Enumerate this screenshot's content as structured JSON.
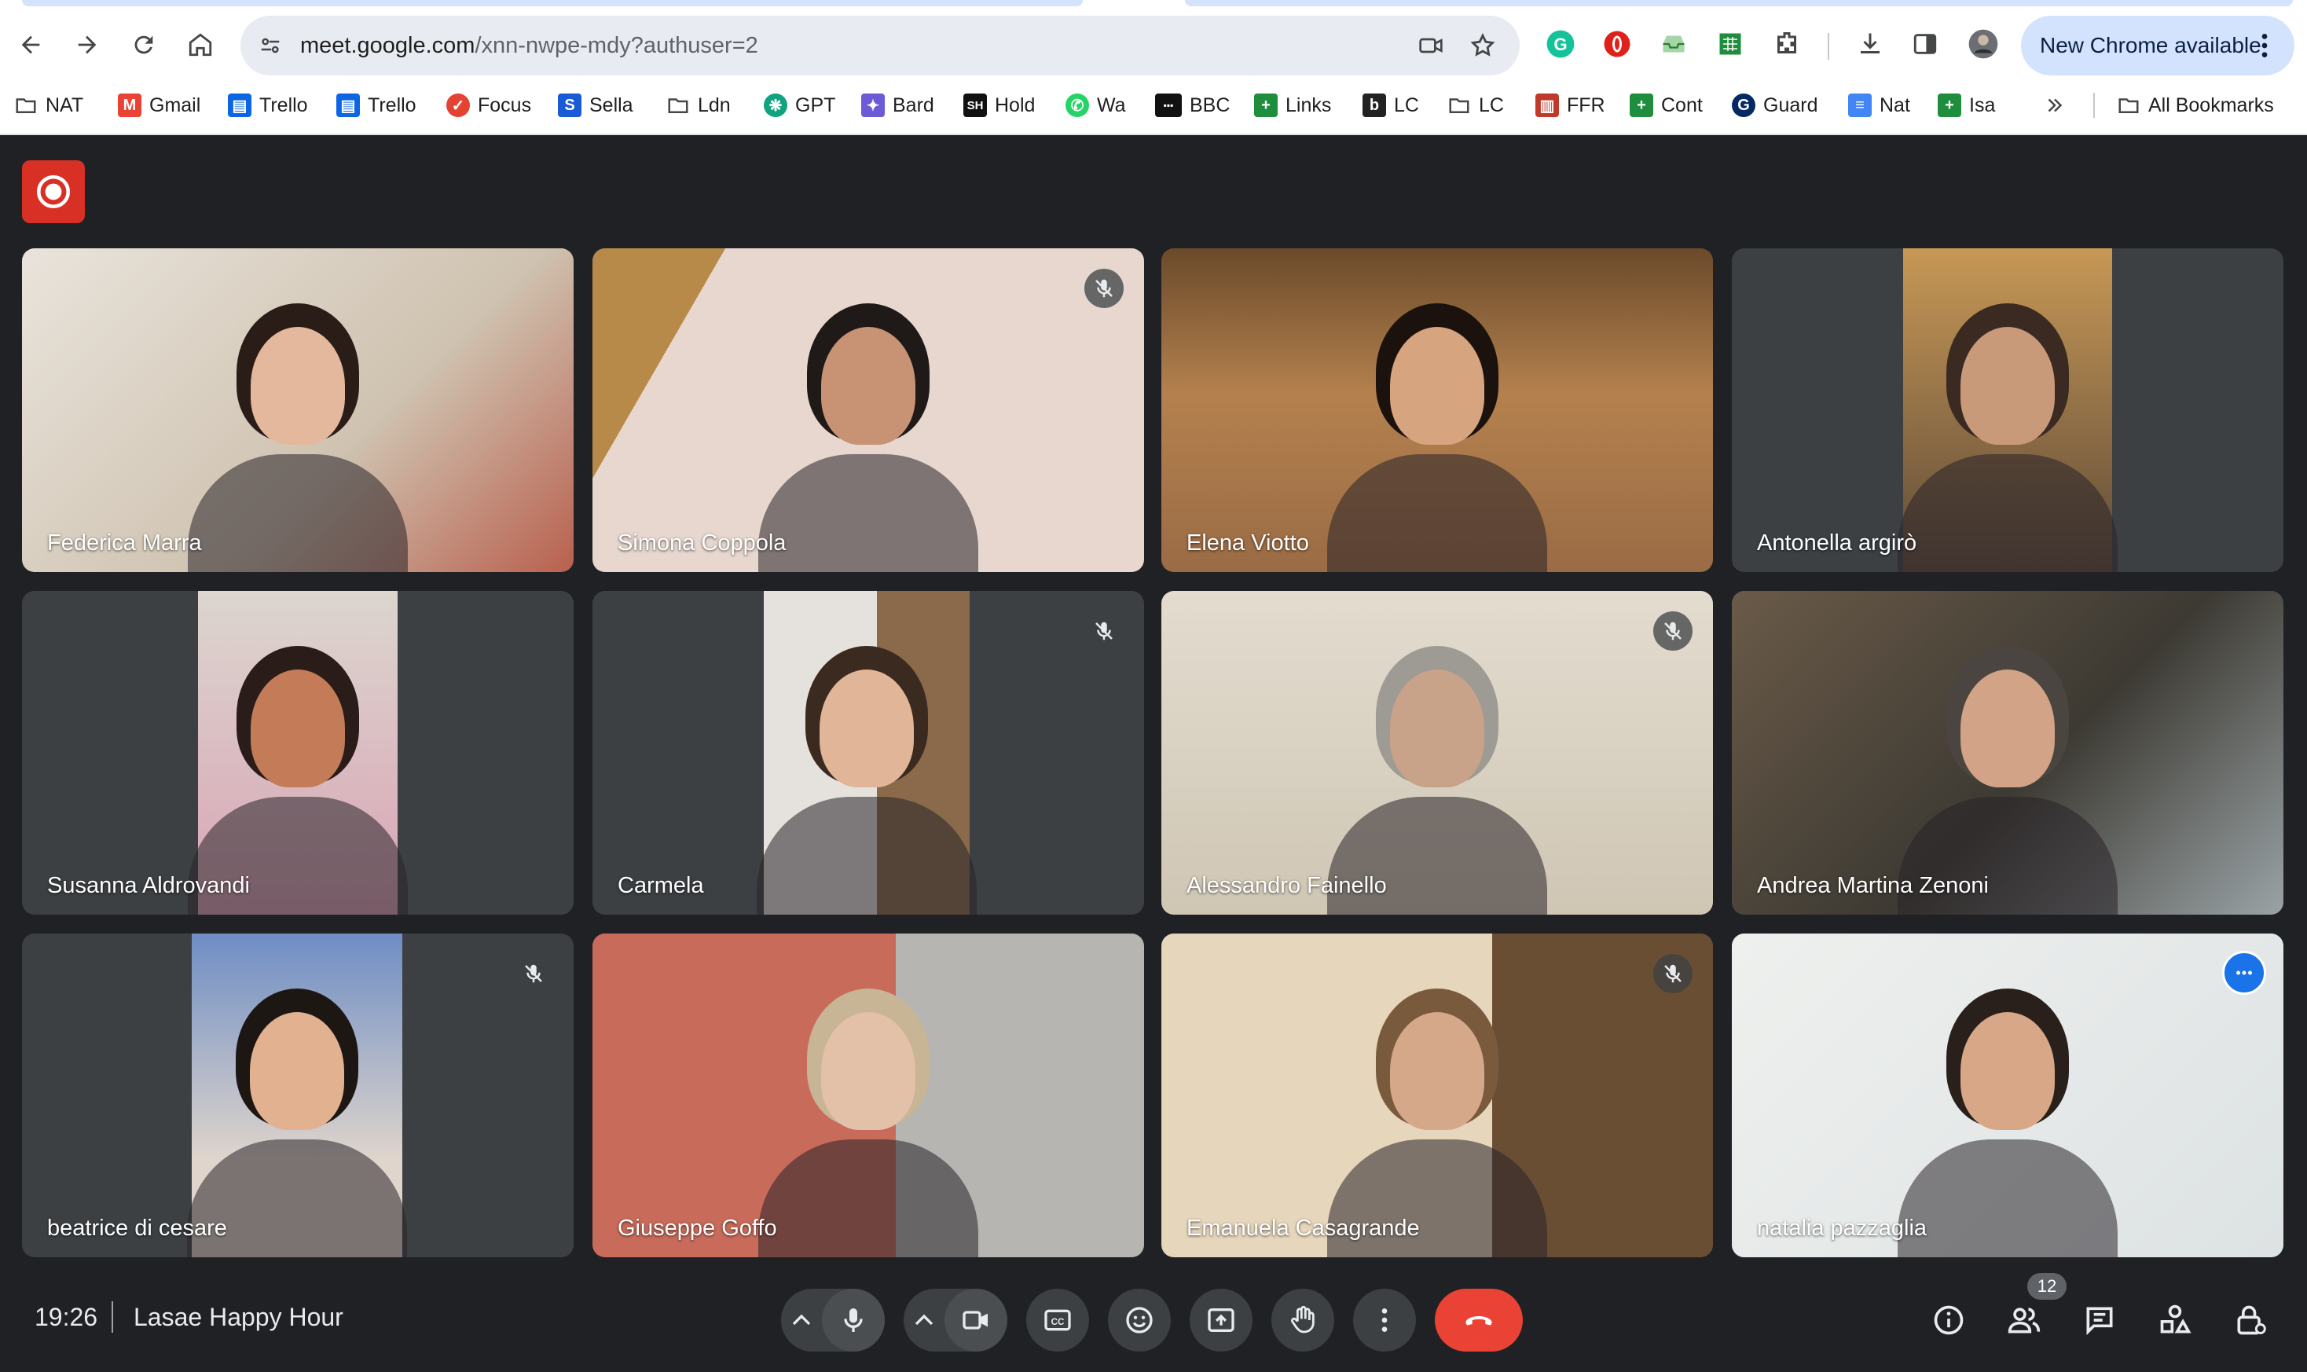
{
  "browser": {
    "url_host": "meet.google.com",
    "url_path": "/xnn-nwpe-mdy?authuser=2",
    "update_label": "New Chrome available",
    "bookmarks": [
      {
        "label": "NAT",
        "icon": "folder-icon"
      },
      {
        "label": "Gmail",
        "icon": "gmail-icon"
      },
      {
        "label": "Trello",
        "icon": "trello-icon"
      },
      {
        "label": "Trello",
        "icon": "trello-icon"
      },
      {
        "label": "Focus",
        "icon": "focus-icon"
      },
      {
        "label": "Sella",
        "icon": "sella-icon"
      },
      {
        "label": "Ldn",
        "icon": "folder-icon"
      },
      {
        "label": "GPT",
        "icon": "gpt-icon"
      },
      {
        "label": "Bard",
        "icon": "bard-icon"
      },
      {
        "label": "Hold",
        "icon": "sh-icon"
      },
      {
        "label": "Wa",
        "icon": "whatsapp-icon"
      },
      {
        "label": "BBC",
        "icon": "bbc-icon"
      },
      {
        "label": "Links",
        "icon": "sheets-icon"
      },
      {
        "label": "LC",
        "icon": "b-icon"
      },
      {
        "label": "LC",
        "icon": "folder-icon"
      },
      {
        "label": "FFR",
        "icon": "ffr-icon"
      },
      {
        "label": "Cont",
        "icon": "sheets-icon"
      },
      {
        "label": "Guard",
        "icon": "guardian-icon"
      },
      {
        "label": "Nat",
        "icon": "docs-icon"
      },
      {
        "label": "Isa",
        "icon": "sheets-icon"
      }
    ],
    "all_bookmarks_label": "All Bookmarks"
  },
  "meeting": {
    "time": "19:26",
    "title": "Lasae Happy Hour",
    "participant_count": "12"
  },
  "participants": [
    {
      "name": "Federica Marra",
      "muted": false
    },
    {
      "name": "Simona Coppola",
      "muted": true
    },
    {
      "name": "Elena Viotto",
      "muted": false
    },
    {
      "name": "Antonella argirò",
      "muted": false
    },
    {
      "name": "Susanna Aldrovandi",
      "muted": false
    },
    {
      "name": "Carmela",
      "muted": true
    },
    {
      "name": "Alessandro Fainello",
      "muted": true
    },
    {
      "name": "Andrea Martina Zenoni",
      "muted": false
    },
    {
      "name": "beatrice di cesare",
      "muted": true
    },
    {
      "name": "Giuseppe Goffo",
      "muted": false
    },
    {
      "name": "Emanuela Casagrande",
      "muted": true
    },
    {
      "name": "natalia pazzaglia",
      "muted": false,
      "active": true
    }
  ],
  "colors": {
    "meet_bg": "#202124",
    "tile_bg": "#3c4043",
    "hangup": "#ea4335",
    "record": "#d93025",
    "active_outline": "#8ab4f8"
  }
}
